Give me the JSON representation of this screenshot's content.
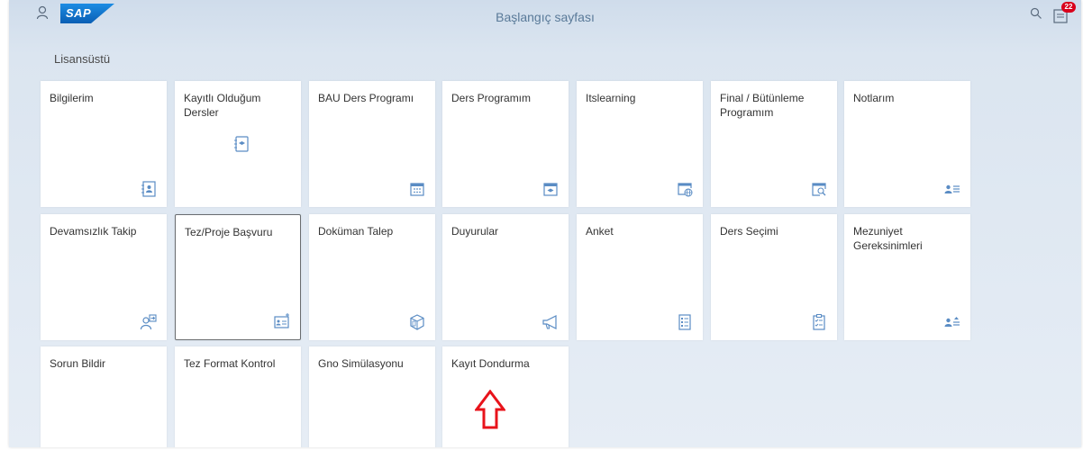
{
  "header": {
    "title": "Başlangıç sayfası",
    "logo_text": "SAP",
    "notification_count": "22",
    "icons": [
      "user-icon",
      "sap-logo",
      "search-icon",
      "notifications-icon"
    ],
    "colors": {
      "accent": "#0a6ed1",
      "badge": "#d9001b",
      "arrow": "#e8131b"
    }
  },
  "section": {
    "title": "Lisansüstü"
  },
  "tiles": [
    {
      "label": "Bilgilerim",
      "icon": "contact-card-icon"
    },
    {
      "label": "Kayıtlı Olduğum Dersler",
      "icon": "course-book-icon"
    },
    {
      "label": "BAU Ders Programı",
      "icon": "calendar-icon"
    },
    {
      "label": "Ders Programım",
      "icon": "education-calendar-icon"
    },
    {
      "label": "Itslearning",
      "icon": "globe-calendar-icon"
    },
    {
      "label": "Final / Bütünleme Programım",
      "icon": "calendar-search-icon"
    },
    {
      "label": "Notlarım",
      "icon": "person-list-icon"
    },
    {
      "label": "Devamsızlık Takip",
      "icon": "person-arrow-icon"
    },
    {
      "label": "Tez/Proje Başvuru",
      "icon": "add-document-icon"
    },
    {
      "label": "Doküman Talep",
      "icon": "product-box-icon"
    },
    {
      "label": "Duyurular",
      "icon": "megaphone-icon"
    },
    {
      "label": "Anket",
      "icon": "survey-icon"
    },
    {
      "label": "Ders Seçimi",
      "icon": "checklist-icon"
    },
    {
      "label": "Mezuniyet Gereksinimleri",
      "icon": "person-requirements-icon"
    },
    {
      "label": "Sorun Bildir",
      "icon": "warning-list-icon"
    },
    {
      "label": "Tez Format Kontrol",
      "icon": "checkmark-icon"
    },
    {
      "label": "Gno Simülasyonu",
      "icon": "calculator-icon"
    },
    {
      "label": "Kayıt Dondurma",
      "icon": "unlock-icon"
    }
  ],
  "annotation": {
    "icon": "red-up-arrow-icon"
  }
}
